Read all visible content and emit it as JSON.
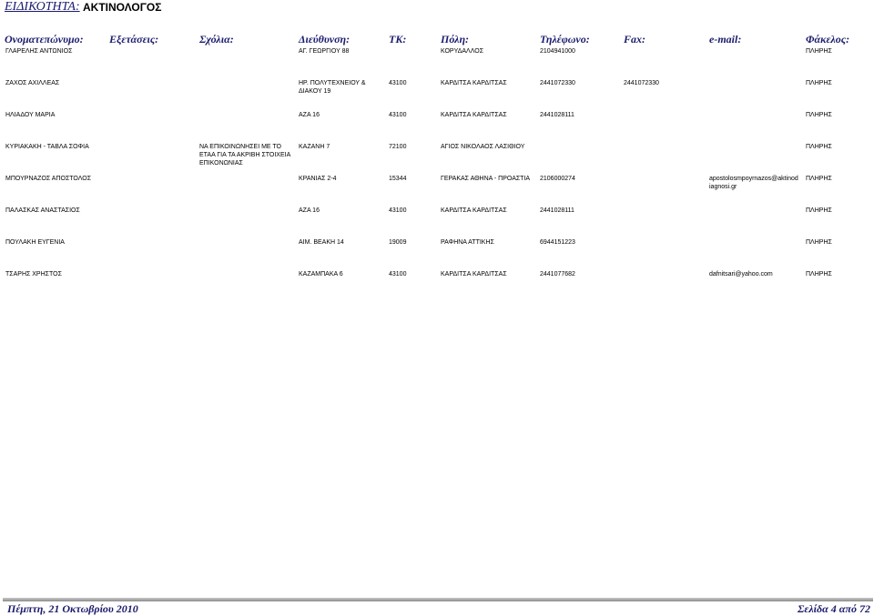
{
  "heading": {
    "label": "ΕΙΔΙΚΟΤΗΤΑ:",
    "value": "ΑΚΤΙΝΟΛΟΓΟΣ"
  },
  "columns": {
    "name": "Ονοματεπώνυμο:",
    "exams": "Εξετάσεις:",
    "notes": "Σχόλια:",
    "address": "Διεύθυνση:",
    "tk": "ΤΚ:",
    "city": "Πόλη:",
    "phone": "Τηλέφωνο:",
    "fax": "Fax:",
    "email": "e-mail:",
    "file": "Φάκελος:"
  },
  "rows": [
    {
      "name": "ΓΛΑΡΕΛΗΣ ΑΝΤΩΝΙΟΣ",
      "exams": "",
      "address": "ΑΓ. ΓΕΩΡΓΙΟΥ 88",
      "tk": "",
      "city": "ΚΟΡΥΔΑΛΛΟΣ",
      "phone": "2104941000",
      "fax": "",
      "email": "",
      "file": "ΠΛΗΡΗΣ"
    },
    {
      "name": "ΖΑΧΟΣ ΑΧΙΛΛΕΑΣ",
      "exams": "",
      "address": "ΗΡ. ΠΟΛΥΤΕΧΝΕΙΟΥ & ΔΙΑΚΟΥ 19",
      "tk": "43100",
      "city": "ΚΑΡΔΙΤΣΑ ΚΑΡΔΙΤΣΑΣ",
      "phone": "2441072330",
      "fax": "2441072330",
      "email": "",
      "file": "ΠΛΗΡΗΣ"
    },
    {
      "name": "ΗΛΙΑΔΟΥ ΜΑΡΙΑ",
      "exams": "",
      "address": "ΑΖΑ 16",
      "tk": "43100",
      "city": "ΚΑΡΔΙΤΣΑ ΚΑΡΔΙΤΣΑΣ",
      "phone": "2441028111",
      "fax": "",
      "email": "",
      "file": "ΠΛΗΡΗΣ"
    },
    {
      "name": "ΚΥΡΙΑΚΑΚΗ - ΤΑΒΛΑ ΣΟΦΙΑ",
      "exams": "ΝΑ ΕΠΙΚΟΙΝΩΝΗΣΕΙ ΜΕ ΤΟ ΕΤΑΑ ΓΙΑ ΤΑ ΑΚΡΙΒΗ ΣΤΟΙΧΕΙΑ ΕΠΙΚΟΝΩΝΙΑΣ",
      "address": "ΚΑΖΑΝΗ 7",
      "tk": "72100",
      "city": "ΑΓΙΟΣ ΝΙΚΟΛΑΟΣ ΛΑΣΙΘΙΟΥ",
      "phone": "",
      "fax": "",
      "email": "",
      "file": "ΠΛΗΡΗΣ"
    },
    {
      "name": "ΜΠΟΥΡΝΑΖΟΣ ΑΠΟΣΤΟΛΟΣ",
      "exams": "",
      "address": "ΚΡΑΝΙΑΣ 2-4",
      "tk": "15344",
      "city": "ΓΕΡΑΚΑΣ ΑΘΗΝΑ - ΠΡΟΑΣΤΙΑ",
      "phone": "2106000274",
      "fax": "",
      "email": "apostolosmpoyrnazos@aktinodiagnosi.gr",
      "file": "ΠΛΗΡΗΣ"
    },
    {
      "name": "ΠΑΛΑΣΚΑΣ ΑΝΑΣΤΑΣΙΟΣ",
      "exams": "",
      "address": "ΑΖΑ 16",
      "tk": "43100",
      "city": "ΚΑΡΔΙΤΣΑ ΚΑΡΔΙΤΣΑΣ",
      "phone": "2441028111",
      "fax": "",
      "email": "",
      "file": "ΠΛΗΡΗΣ"
    },
    {
      "name": "ΠΟΥΛΑΚΗ ΕΥΓΕΝΙΑ",
      "exams": "",
      "address": "ΑΙΜ. ΒΕΑΚΗ 14",
      "tk": "19009",
      "city": "ΡΑΦΗΝΑ ΑΤΤΙΚΗΣ",
      "phone": "6944151223",
      "fax": "",
      "email": "",
      "file": "ΠΛΗΡΗΣ"
    },
    {
      "name": "ΤΣΑΡΗΣ ΧΡΗΣΤΟΣ",
      "exams": "",
      "address": "ΚΑΖΑΜΠΑΚΑ 6",
      "tk": "43100",
      "city": "ΚΑΡΔΙΤΣΑ ΚΑΡΔΙΤΣΑΣ",
      "phone": "2441077682",
      "fax": "",
      "email": "dafnitsari@yahoo.com",
      "file": "ΠΛΗΡΗΣ"
    }
  ],
  "footer": {
    "date": "Πέμπτη, 21 Οκτωβρίου 2010",
    "page": "Σελίδα 4 από 72"
  }
}
